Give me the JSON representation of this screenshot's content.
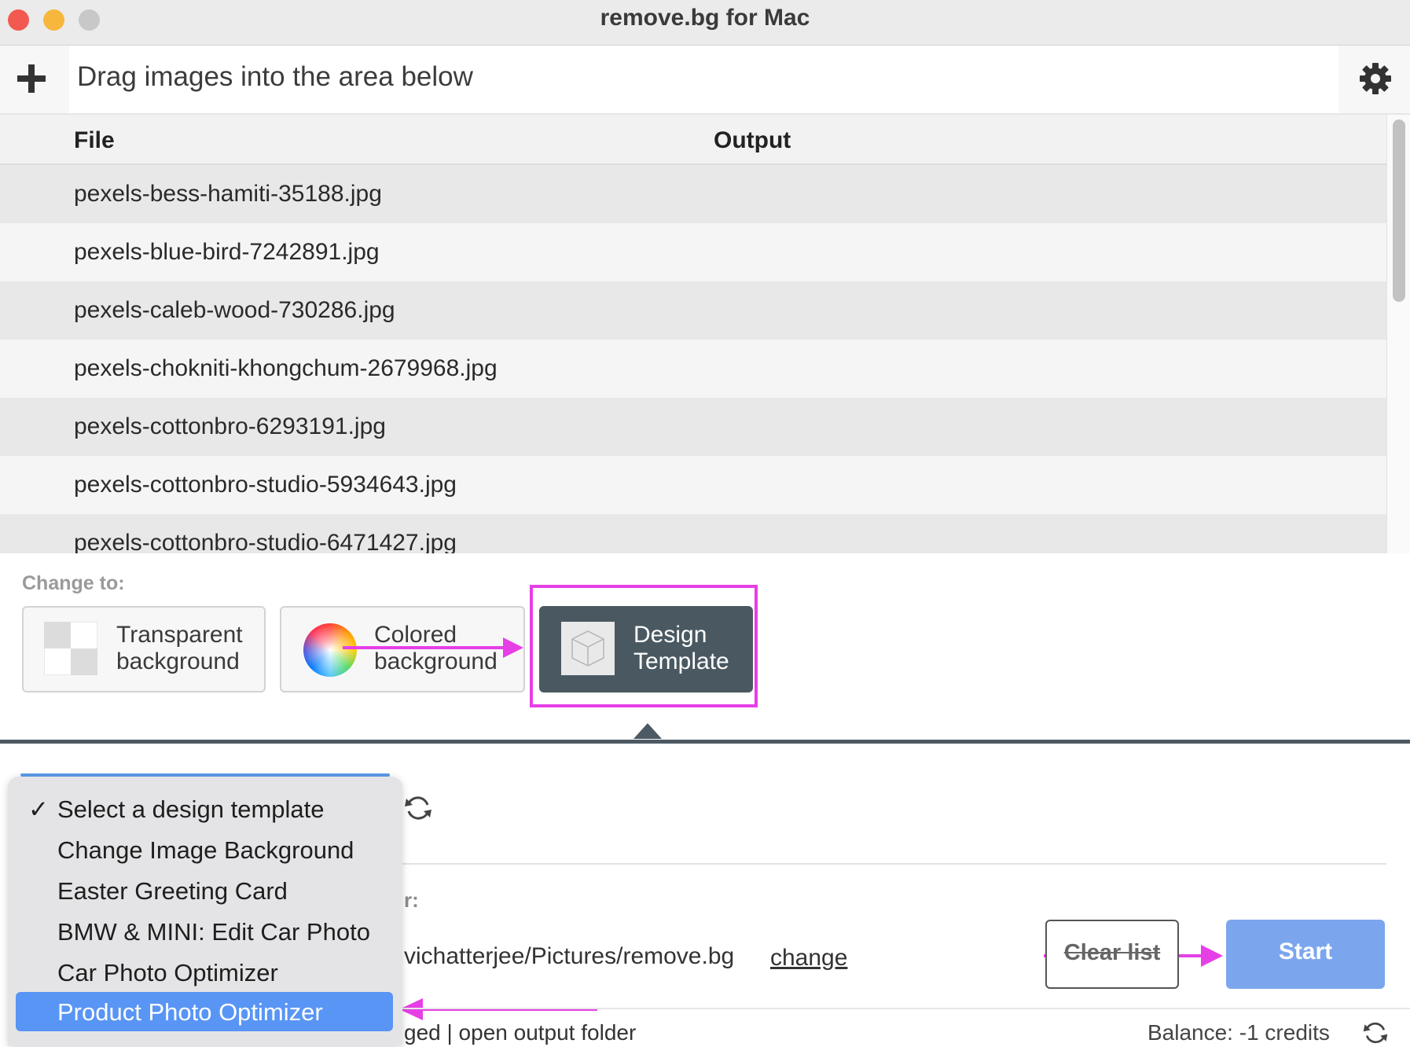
{
  "window": {
    "title": "remove.bg for Mac",
    "traffic_lights": {
      "close": "#f25a51",
      "minimize": "#f6b73c",
      "zoom": "#c8c8c8"
    }
  },
  "toolbar": {
    "drag_hint": "Drag images into the area below",
    "add_icon": "plus-icon",
    "settings_icon": "gear-icon"
  },
  "table": {
    "columns": [
      "File",
      "Output"
    ],
    "rows": [
      "pexels-bess-hamiti-35188.jpg",
      "pexels-blue-bird-7242891.jpg",
      "pexels-caleb-wood-730286.jpg",
      "pexels-chokniti-khongchum-2679968.jpg",
      "pexels-cottonbro-6293191.jpg",
      "pexels-cottonbro-studio-5934643.jpg",
      "pexels-cottonbro-studio-6471427.jpg"
    ]
  },
  "change_to": {
    "label": "Change to:",
    "options": [
      {
        "line1": "Transparent",
        "line2": "background",
        "icon": "checkerboard-icon"
      },
      {
        "line1": "Colored",
        "line2": "background",
        "icon": "color-wheel-icon"
      },
      {
        "line1": "Design",
        "line2": "Template",
        "icon": "cube-icon"
      }
    ],
    "selected": "Design Template"
  },
  "design_template_menu": {
    "items": [
      "Select a design template",
      "Change Image Background",
      "Easter Greeting Card",
      "BMW & MINI: Edit Car Photo",
      "Car Photo Optimizer",
      "Product Photo Optimizer"
    ],
    "checkmark": "✓",
    "checked_item": "Select a design template",
    "highlighted_item": "Product Photo Optimizer"
  },
  "output": {
    "folder_label_fragment": "r:",
    "path_fragment": "vichatterjee/Pictures/remove.bg",
    "change_link": "change",
    "status_fragment": "ged | open output folder"
  },
  "actions": {
    "clear_label": "Clear list",
    "start_label": "Start"
  },
  "balance": "Balance: -1 credits",
  "colors": {
    "accent_magenta": "#e63fe6",
    "start_button": "#7ba6ee",
    "menu_highlight": "#5895f5",
    "divider": "#4d5a63"
  }
}
